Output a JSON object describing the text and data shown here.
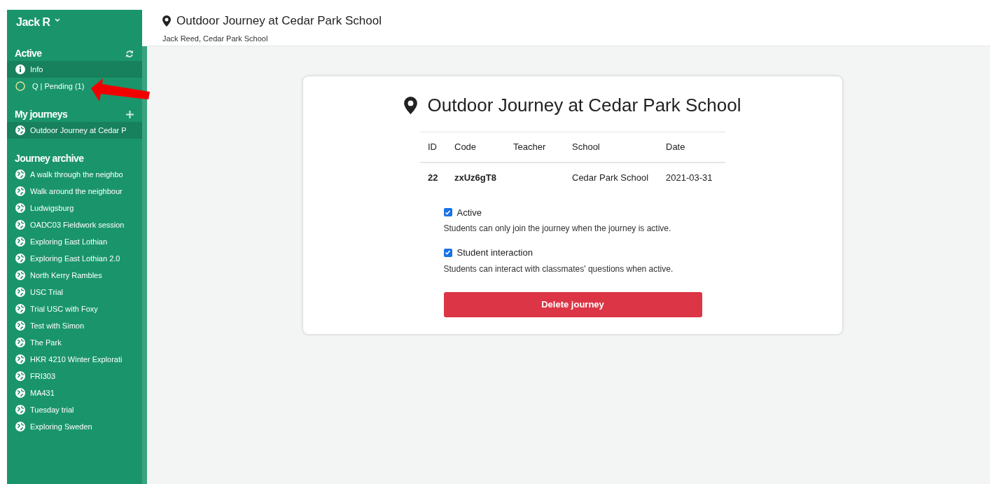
{
  "sidebar": {
    "user": "Jack R",
    "sections": [
      {
        "title": "Active",
        "items": [
          {
            "label": "Info",
            "kind": "info",
            "selected": true
          },
          {
            "label": "Q | Pending (1)",
            "kind": "question",
            "selected": false
          }
        ]
      },
      {
        "title": "My journeys",
        "items": [
          {
            "label": "Outdoor Journey at Cedar P",
            "selected": true
          }
        ]
      },
      {
        "title": "Journey archive",
        "items": [
          {
            "label": "A walk through the neighbo",
            "selected": false
          },
          {
            "label": "Walk around the neighbour",
            "selected": false
          },
          {
            "label": "Ludwigsburg",
            "selected": false
          },
          {
            "label": "OADC03 Fieldwork session",
            "selected": false
          },
          {
            "label": "Exploring East Lothian",
            "selected": false
          },
          {
            "label": "Exploring East Lothian 2.0",
            "selected": false
          },
          {
            "label": "North Kerry Rambles",
            "selected": false
          },
          {
            "label": "USC Trial",
            "selected": false
          },
          {
            "label": "Trial USC with Foxy",
            "selected": false
          },
          {
            "label": "Test with Simon",
            "selected": false
          },
          {
            "label": "The Park",
            "selected": false
          },
          {
            "label": "HKR 4210 Winter Explorati",
            "selected": false
          },
          {
            "label": "FRI303",
            "selected": false
          },
          {
            "label": "MA431",
            "selected": false
          },
          {
            "label": "Tuesday trial",
            "selected": false
          },
          {
            "label": "Exploring Sweden",
            "selected": false
          }
        ]
      }
    ]
  },
  "header": {
    "title": "Outdoor Journey at Cedar Park School",
    "subtitle": "Jack Reed, Cedar Park School"
  },
  "card": {
    "title": "Outdoor Journey at Cedar Park School",
    "table": {
      "columns": [
        "ID",
        "Code",
        "Teacher",
        "School",
        "Date"
      ],
      "rows": [
        [
          "22",
          "zxUz6gT8",
          "",
          "Cedar Park School",
          "2021-03-31"
        ]
      ]
    },
    "options": [
      {
        "label": "Active",
        "checked": true,
        "description": "Students can only join the journey when the journey is active."
      },
      {
        "label": "Student interaction",
        "checked": true,
        "description": "Students can interact with classmates' questions when active."
      }
    ],
    "button": "Delete journey"
  }
}
